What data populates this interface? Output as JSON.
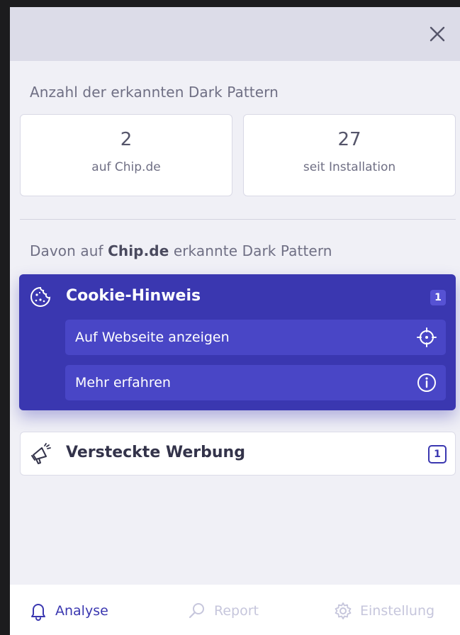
{
  "header": {
    "close_icon": "close-icon"
  },
  "summary": {
    "title": "Anzahl der erkannten Dark Pattern",
    "cards": [
      {
        "value": "2",
        "label": "auf Chip.de"
      },
      {
        "value": "27",
        "label": "seit Installation"
      }
    ]
  },
  "details": {
    "title_prefix": "Davon auf ",
    "title_site": "Chip.de",
    "title_suffix": " erkannte Dark Pattern"
  },
  "patterns": [
    {
      "name": "Cookie-Hinweis",
      "count": "1",
      "icon": "cookie-icon",
      "actions": [
        {
          "label": "Auf Webseite anzeigen",
          "icon": "target-icon"
        },
        {
          "label": "Mehr erfahren",
          "icon": "info-icon"
        }
      ]
    },
    {
      "name": "Versteckte Werbung",
      "count": "1",
      "icon": "megaphone-icon"
    }
  ],
  "nav": [
    {
      "label": "Analyse",
      "icon": "bell-icon",
      "active": true
    },
    {
      "label": "Report",
      "icon": "search-icon",
      "active": false
    },
    {
      "label": "Einstellung",
      "icon": "gear-icon",
      "active": false
    }
  ],
  "colors": {
    "accent": "#3a37b0",
    "accent_light": "#4946c6",
    "nav_inactive": "#c6c6dc"
  }
}
